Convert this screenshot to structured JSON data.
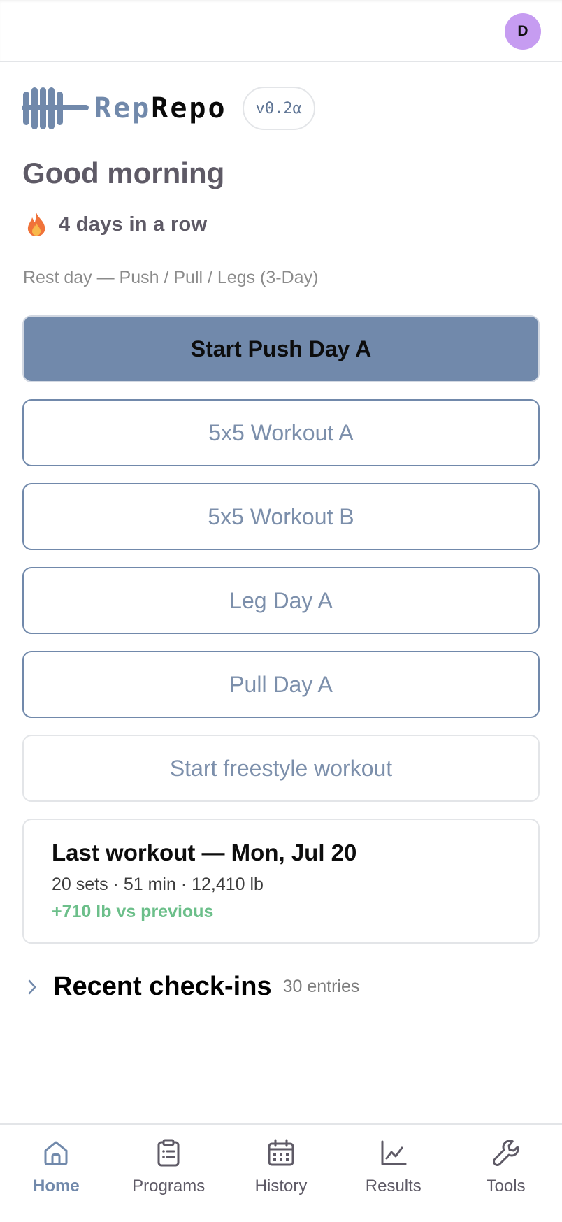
{
  "header": {
    "avatar_initial": "D"
  },
  "brand": {
    "rep": "Rep",
    "repo": "Repo",
    "version": "v0.2α"
  },
  "home": {
    "greeting": "Good morning",
    "streak": "4 days in a row",
    "rest_day": "Rest day — Push / Pull / Legs (3-Day)",
    "primary_button": "Start Push Day A",
    "workout_buttons": [
      "5x5 Workout A",
      "5x5 Workout B",
      "Leg Day A",
      "Pull Day A"
    ],
    "freestyle_button": "Start freestyle workout"
  },
  "last_workout": {
    "title": "Last workout — Mon, Jul 20",
    "stats": "20 sets · 51 min · 12,410 lb",
    "delta": "+710 lb vs previous"
  },
  "recent": {
    "title": "Recent check-ins",
    "count": "30 entries"
  },
  "tabs": [
    {
      "label": "Home",
      "icon": "home-icon",
      "active": true
    },
    {
      "label": "Programs",
      "icon": "clipboard-icon",
      "active": false
    },
    {
      "label": "History",
      "icon": "calendar-icon",
      "active": false
    },
    {
      "label": "Results",
      "icon": "chart-icon",
      "active": false
    },
    {
      "label": "Tools",
      "icon": "wrench-icon",
      "active": false
    }
  ],
  "colors": {
    "accent": "#7189ab",
    "avatar": "#c69cf1",
    "positive": "#6cbf8a",
    "heading": "#5e5a66"
  }
}
